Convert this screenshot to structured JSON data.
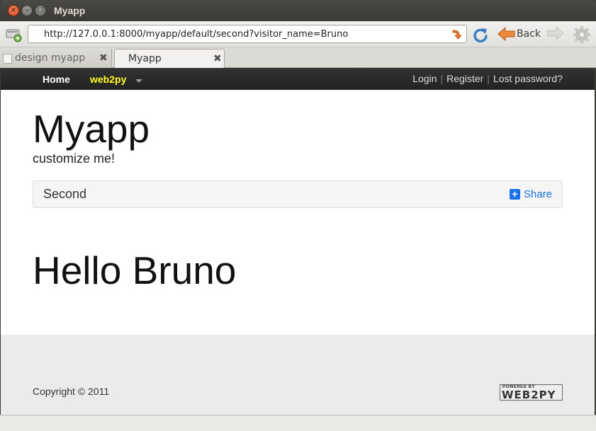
{
  "window": {
    "title": "Myapp"
  },
  "navbar": {
    "url": "http://127.0.0.1:8000/myapp/default/second?visitor_name=Bruno",
    "back_label": "Back"
  },
  "tabs": [
    {
      "label": "design myapp",
      "active": false
    },
    {
      "label": "Myapp",
      "active": true
    }
  ],
  "page": {
    "topbar": {
      "home": "Home",
      "brand": "web2py",
      "login": "Login",
      "register": "Register",
      "lost_password": "Lost password?",
      "separator": "|"
    },
    "title": "Myapp",
    "subtitle": "customize me!",
    "breadcrumb": "Second",
    "share_label": "Share",
    "share_plus": "+",
    "greeting": "Hello Bruno",
    "footer": {
      "copyright": "Copyright © 2011",
      "badge_top": "POWERED BY",
      "badge_main": "WEB2PY"
    }
  },
  "colors": {
    "brand_accent": "#ffff22",
    "share_blue": "#1a73e8",
    "window_close": "#d9461c"
  }
}
